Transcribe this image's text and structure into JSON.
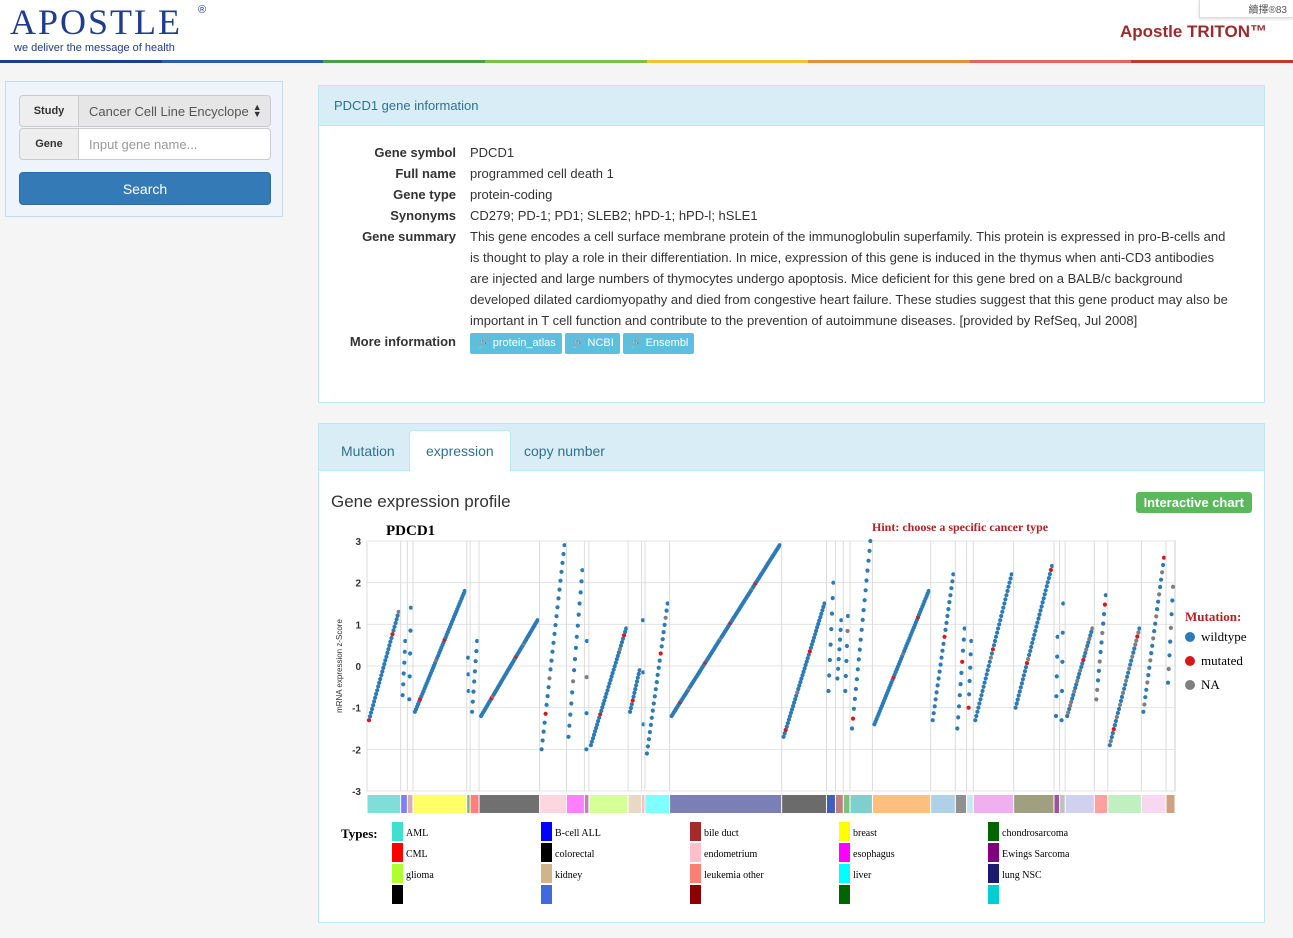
{
  "header": {
    "logo": "APOSTLE",
    "logo_mark": "®",
    "tagline": "we deliver the message of health",
    "brand": "Apostle TRITON™",
    "popup_text": "續擇®83"
  },
  "rainbow_colors": [
    "#1f3d8a",
    "#2a5db0",
    "#4aa04a",
    "#7cc242",
    "#f1c232",
    "#e69138",
    "#e06666",
    "#c0392b"
  ],
  "sidebar": {
    "study_label": "Study",
    "study_value": "Cancer Cell Line Encyclope",
    "gene_label": "Gene",
    "gene_placeholder": "Input gene name...",
    "search_label": "Search"
  },
  "gene_info": {
    "heading": "PDCD1 gene information",
    "rows": [
      {
        "key": "Gene symbol",
        "value": "PDCD1"
      },
      {
        "key": "Full name",
        "value": "programmed cell death 1"
      },
      {
        "key": "Gene type",
        "value": "protein-coding"
      },
      {
        "key": "Synonyms",
        "value": "CD279; PD-1; PD1; SLEB2; hPD-1; hPD-l; hSLE1"
      },
      {
        "key": "Gene summary",
        "value": "This gene encodes a cell surface membrane protein of the immunoglobulin superfamily. This protein is expressed in pro-B-cells and is thought to play a role in their differentiation. In mice, expression of this gene is induced in the thymus when anti-CD3 antibodies are injected and large numbers of thymocytes undergo apoptosis. Mice deficient for this gene bred on a BALB/c background developed dilated cardiomyopathy and died from congestive heart failure. These studies suggest that this gene product may also be important in T cell function and contribute to the prevention of autoimmune diseases. [provided by RefSeq, Jul 2008]"
      }
    ],
    "more_label": "More information",
    "links": [
      "protein_atlas",
      "NCBI",
      "Ensembl"
    ]
  },
  "tabs": [
    {
      "label": "Mutation",
      "active": false
    },
    {
      "label": "expression",
      "active": true
    },
    {
      "label": "copy number",
      "active": false
    }
  ],
  "expression": {
    "title": "Gene expression profile",
    "interactive_label": "Interactive chart"
  },
  "chart_data": {
    "type": "scatter",
    "title": "PDCD1",
    "hint": "Hint: choose a specific cancer type",
    "ylabel": "mRNA expression z-Score",
    "xlabel": "",
    "ylim": [
      -3,
      3
    ],
    "yticks": [
      3,
      2,
      1,
      0,
      -1,
      -2,
      -3
    ],
    "grid": true,
    "legend_title": "Mutation:",
    "legend_position": "right",
    "legend": [
      {
        "name": "wildtype",
        "color": "#2c7bb6"
      },
      {
        "name": "mutated",
        "color": "#d7191c"
      },
      {
        "name": "NA",
        "color": "#7f7f7f"
      }
    ],
    "types_label": "Types:",
    "cancer_types": [
      {
        "name": "AML",
        "color": "#40e0d0"
      },
      {
        "name": "B-cell ALL",
        "color": "#0000ff"
      },
      {
        "name": "bile duct",
        "color": "#a52a2a"
      },
      {
        "name": "breast",
        "color": "#ffff00"
      },
      {
        "name": "chondrosarcoma",
        "color": "#006400"
      },
      {
        "name": "CML",
        "color": "#ff0000"
      },
      {
        "name": "colorectal",
        "color": "#000000"
      },
      {
        "name": "endometrium",
        "color": "#ffc0cb"
      },
      {
        "name": "esophagus",
        "color": "#ff00ff"
      },
      {
        "name": "Ewings Sarcoma",
        "color": "#800080"
      },
      {
        "name": "glioma",
        "color": "#adff2f"
      },
      {
        "name": "kidney",
        "color": "#d2b48c"
      },
      {
        "name": "leukemia other",
        "color": "#fa8072"
      },
      {
        "name": "liver",
        "color": "#00ffff"
      },
      {
        "name": "lung NSC",
        "color": "#191970"
      }
    ],
    "groups": [
      {
        "color": "#7fdfd8",
        "n": 30,
        "min": -1.3,
        "max": 1.3
      },
      {
        "color": "#7f7fff",
        "n": 6,
        "min": -0.7,
        "max": 0.6
      },
      {
        "color": "#d6b0b0",
        "n": 5,
        "min": -0.8,
        "max": 1.4
      },
      {
        "color": "#ffff66",
        "n": 48,
        "min": -1.1,
        "max": 1.8
      },
      {
        "color": "#7fb27f",
        "n": 3,
        "min": -0.6,
        "max": 0.2
      },
      {
        "color": "#ff7f7f",
        "n": 8,
        "min": -1.1,
        "max": 0.6
      },
      {
        "color": "#707070",
        "n": 54,
        "min": -1.2,
        "max": 1.1
      },
      {
        "color": "#ffd6df",
        "n": 24,
        "min": -2.0,
        "max": 2.9
      },
      {
        "color": "#ff7fff",
        "n": 16,
        "min": -1.7,
        "max": 2.3
      },
      {
        "color": "#bf7fbf",
        "n": 4,
        "min": -2.0,
        "max": 0.6
      },
      {
        "color": "#d6ff97",
        "n": 35,
        "min": -1.9,
        "max": 0.9
      },
      {
        "color": "#e8d8c4",
        "n": 12,
        "min": -1.1,
        "max": -0.1
      },
      {
        "color": "#fdbfb8",
        "n": 3,
        "min": -1.4,
        "max": 1.1
      },
      {
        "color": "#7fffff",
        "n": 22,
        "min": -2.1,
        "max": 1.5
      },
      {
        "color": "#7a7fb5",
        "n": 100,
        "min": -1.2,
        "max": 2.9
      },
      {
        "color": "#6b6b6b",
        "n": 40,
        "min": -1.7,
        "max": 1.5
      },
      {
        "color": "#3f5fbf",
        "n": 8,
        "min": -0.6,
        "max": 2.0
      },
      {
        "color": "#bf7f7f",
        "n": 7,
        "min": -0.3,
        "max": 1.1
      },
      {
        "color": "#7fbf7f",
        "n": 6,
        "min": -0.6,
        "max": 1.2
      },
      {
        "color": "#7fcfcf",
        "n": 20,
        "min": -1.5,
        "max": 3.0
      },
      {
        "color": "#ffbf7f",
        "n": 52,
        "min": -1.4,
        "max": 1.8
      },
      {
        "color": "#b0d0e8",
        "n": 22,
        "min": -1.3,
        "max": 2.2
      },
      {
        "color": "#909090",
        "n": 10,
        "min": -1.5,
        "max": 0.9
      },
      {
        "color": "#c8e8f0",
        "n": 6,
        "min": -1.0,
        "max": 0.6
      },
      {
        "color": "#f0b0f0",
        "n": 36,
        "min": -1.3,
        "max": 2.2
      },
      {
        "color": "#a0a080",
        "n": 36,
        "min": -1.0,
        "max": 2.4
      },
      {
        "color": "#a050a0",
        "n": 5,
        "min": -1.2,
        "max": 0.7
      },
      {
        "color": "#c0c0c0",
        "n": 5,
        "min": -1.3,
        "max": 1.5
      },
      {
        "color": "#d0d0f0",
        "n": 26,
        "min": -1.2,
        "max": 0.9
      },
      {
        "color": "#ff9f9f",
        "n": 12,
        "min": -0.8,
        "max": 1.7
      },
      {
        "color": "#c0f0c0",
        "n": 30,
        "min": -1.9,
        "max": 0.9
      },
      {
        "color": "#f8d8f0",
        "n": 22,
        "min": -1.1,
        "max": 2.6
      },
      {
        "color": "#d0a080",
        "n": 8,
        "min": -0.4,
        "max": 1.9
      }
    ]
  }
}
